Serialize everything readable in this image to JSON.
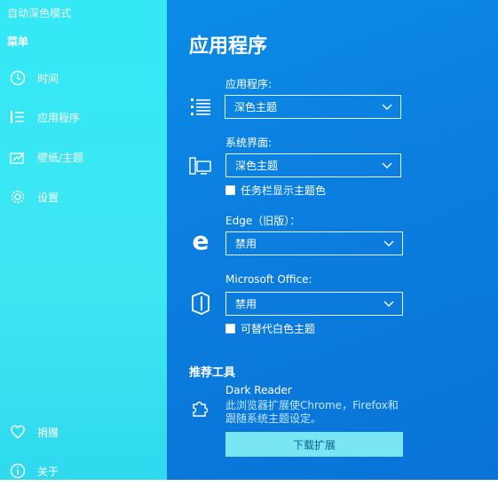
{
  "app": {
    "title": "自动深色模式"
  },
  "sidebar": {
    "menu_title": "菜单",
    "items": [
      {
        "label": "时间",
        "icon": "clock-icon"
      },
      {
        "label": "应用程序",
        "icon": "list-icon"
      },
      {
        "label": "壁纸/主题",
        "icon": "brush-icon"
      },
      {
        "label": "设置",
        "icon": "gear-icon"
      }
    ],
    "bottom_items": [
      {
        "label": "捐赠",
        "icon": "heart-icon"
      },
      {
        "label": "关于",
        "icon": "info-icon"
      }
    ]
  },
  "main": {
    "title": "应用程序",
    "sections": [
      {
        "label": "应用程序:",
        "value": "深色主题",
        "icon": "list-icon"
      },
      {
        "label": "系统界面:",
        "value": "深色主题",
        "icon": "monitor-icon",
        "checkbox": "任务栏显示主题色"
      },
      {
        "label": "Edge（旧版）：",
        "value": "禁用",
        "icon": "edge-icon"
      },
      {
        "label": "Microsoft Office:",
        "value": "禁用",
        "icon": "office-icon",
        "checkbox": "可替代白色主题"
      }
    ],
    "recommended": {
      "heading": "推荐工具",
      "tool_name": "Dark Reader",
      "desc_line1": "此浏览器扩展使Chrome，Firefox和",
      "desc_line2": "跟随系统主题设定。",
      "button": "下载扩展"
    }
  },
  "colors": {
    "sidebar": "#3ee6f2",
    "main": "#0b7fe0",
    "button": "#7ae6f3"
  }
}
